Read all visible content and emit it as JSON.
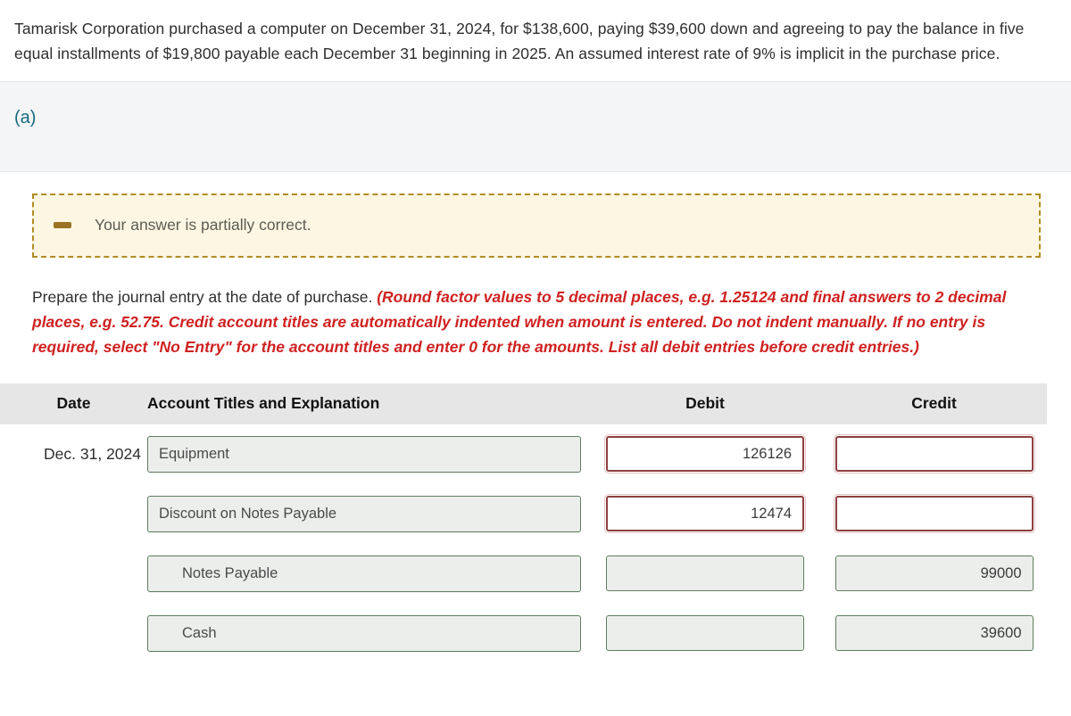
{
  "problem": {
    "text": "Tamarisk Corporation purchased a computer on December 31, 2024, for $138,600, paying $39,600 down and agreeing to pay the balance in five equal installments of $19,800 payable each December 31 beginning in 2025. An assumed interest rate of 9% is implicit in the purchase price."
  },
  "part": {
    "label": "(a)"
  },
  "alert": {
    "icon": "minus-dash-icon",
    "message": "Your answer is partially correct.",
    "background_color": "#fcf6e3",
    "border_color": "#b08d24"
  },
  "instructions": {
    "lead": "Prepare the journal entry at the date of purchase. ",
    "emphasis": "(Round factor values to 5 decimal places, e.g. 1.25124 and final answers to 2 decimal places, e.g. 52.75. Credit account titles are automatically indented when amount is entered. Do not indent manually. If no entry is required, select \"No Entry\" for the account titles and enter 0 for the amounts. List all debit entries before credit entries.)",
    "emphasis_color": "#cf2222"
  },
  "journal": {
    "headers": {
      "date": "Date",
      "account": "Account Titles and Explanation",
      "debit": "Debit",
      "credit": "Credit"
    },
    "rows": [
      {
        "date": "Dec. 31, 2024",
        "account": "Equipment",
        "indented": false,
        "debit": "126126",
        "credit": "",
        "debit_state": "error",
        "credit_state": "error"
      },
      {
        "date": "",
        "account": "Discount on Notes Payable",
        "indented": false,
        "debit": "12474",
        "credit": "",
        "debit_state": "error",
        "credit_state": "error"
      },
      {
        "date": "",
        "account": "Notes Payable",
        "indented": true,
        "debit": "",
        "credit": "99000",
        "debit_state": "ok",
        "credit_state": "ok"
      },
      {
        "date": "",
        "account": "Cash",
        "indented": true,
        "debit": "",
        "credit": "39600",
        "debit_state": "ok",
        "credit_state": "ok"
      }
    ]
  },
  "colors": {
    "valid_border": "#5f7e5f",
    "error_border": "#8d4040",
    "part_label": "#17697f",
    "header_band": "#e6e6e6"
  }
}
